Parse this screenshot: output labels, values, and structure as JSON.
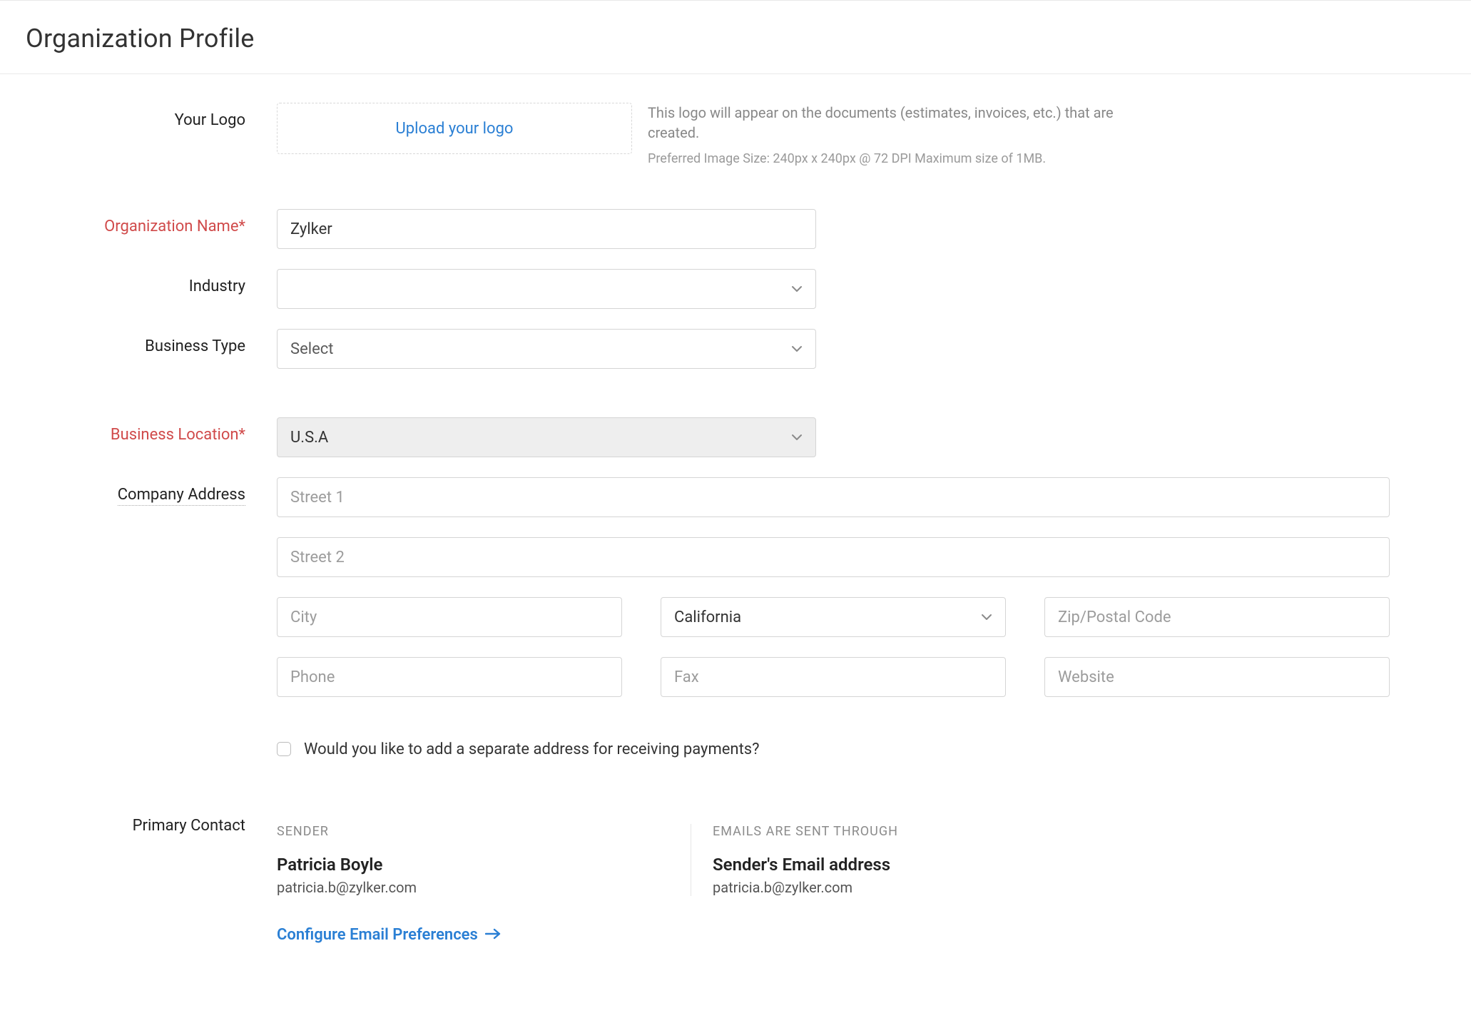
{
  "header": {
    "title": "Organization Profile"
  },
  "labels": {
    "logo": "Your Logo",
    "orgName": "Organization Name*",
    "industry": "Industry",
    "businessType": "Business Type",
    "businessLocation": "Business Location*",
    "companyAddress": "Company Address",
    "primaryContact": "Primary Contact"
  },
  "upload": {
    "linkText": "Upload your logo",
    "hint1": "This logo will appear on the documents (estimates, invoices, etc.) that are created.",
    "hint2": "Preferred Image Size: 240px x 240px @ 72 DPI Maximum size of 1MB."
  },
  "fields": {
    "orgName": "Zylker",
    "industry": "",
    "businessType": "Select",
    "businessLocation": "U.S.A",
    "street1_placeholder": "Street 1",
    "street2_placeholder": "Street 2",
    "city_placeholder": "City",
    "state": "California",
    "zip_placeholder": "Zip/Postal Code",
    "phone_placeholder": "Phone",
    "fax_placeholder": "Fax",
    "website_placeholder": "Website"
  },
  "checkbox": {
    "separateAddress": "Would you like to add a separate address for receiving payments?"
  },
  "contact": {
    "senderHeading": "SENDER",
    "senderName": "Patricia Boyle",
    "senderEmail": "patricia.b@zylker.com",
    "throughHeading": "EMAILS ARE SENT THROUGH",
    "throughName": "Sender's Email address",
    "throughEmail": "patricia.b@zylker.com"
  },
  "configLink": "Configure Email Preferences"
}
